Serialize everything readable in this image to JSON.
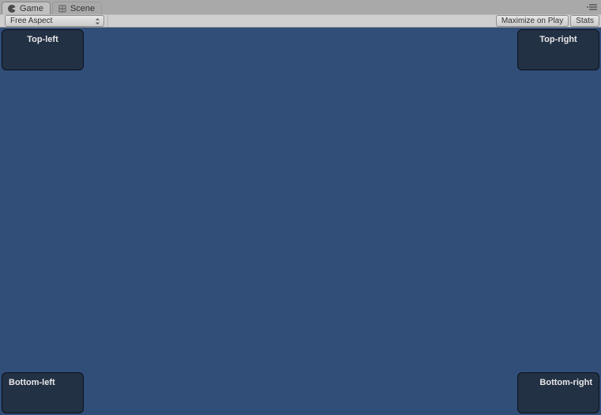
{
  "tabs": {
    "game": "Game",
    "scene": "Scene"
  },
  "toolbar": {
    "aspect": "Free Aspect",
    "maximize": "Maximize on Play",
    "stats": "Stats"
  },
  "corners": {
    "tl": "Top-left",
    "tr": "Top-right",
    "bl": "Bottom-left",
    "br": "Bottom-right"
  }
}
